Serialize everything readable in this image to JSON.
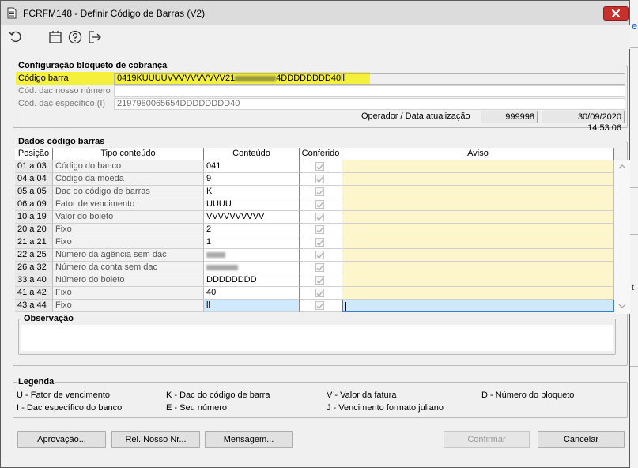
{
  "window": {
    "title": "FCRFM148 - Definir Código de Barras (V2)"
  },
  "toolbar": {
    "icons": [
      "refresh-icon",
      "calendar-icon",
      "help-icon",
      "exit-icon"
    ]
  },
  "config": {
    "legend": "Configuração bloqueto de cobrança",
    "codigo_barra_label": "Código barra",
    "codigo_barra_value_prefix": "0419KUUUUVVVVVVVVVV21",
    "codigo_barra_value_suffix": "4DDDDDDDD40ll",
    "dac_nosso_numero_label": "Cód. dac nosso número",
    "dac_nosso_numero_value": "",
    "dac_especifico_label": "Cód. dac específico (I)",
    "dac_especifico_value": "2197980065654DDDDDDDD40",
    "operador_label": "Operador / Data atualização",
    "operador_value": "999998",
    "data_value": "30/09/2020 14:53:06"
  },
  "dados": {
    "legend": "Dados código barras",
    "columns": [
      "Posição",
      "Tipo conteúdo",
      "Conteúdo",
      "Conferido",
      "Aviso"
    ],
    "rows": [
      {
        "pos": "01 a 03",
        "tipo": "Código do banco",
        "conteudo": "041",
        "conferido": true,
        "aviso": ""
      },
      {
        "pos": "04 a 04",
        "tipo": "Código da moeda",
        "conteudo": "9",
        "conferido": true,
        "aviso": ""
      },
      {
        "pos": "05 a 05",
        "tipo": "Dac do código de barras",
        "conteudo": "K",
        "conferido": true,
        "aviso": ""
      },
      {
        "pos": "06 a 09",
        "tipo": "Fator de vencimento",
        "conteudo": "UUUU",
        "conferido": true,
        "aviso": ""
      },
      {
        "pos": "10 a 19",
        "tipo": "Valor do boleto",
        "conteudo": "VVVVVVVVVV",
        "conferido": true,
        "aviso": ""
      },
      {
        "pos": "20 a 20",
        "tipo": "Fixo",
        "conteudo": "2",
        "conferido": true,
        "aviso": ""
      },
      {
        "pos": "21 a 21",
        "tipo": "Fixo",
        "conteudo": "1",
        "conferido": true,
        "aviso": ""
      },
      {
        "pos": "22 a 25",
        "tipo": "Número da agência sem dac",
        "conteudo": "",
        "conferido": true,
        "aviso": ""
      },
      {
        "pos": "26 a 32",
        "tipo": "Número da conta sem dac",
        "conteudo": "",
        "conferido": true,
        "aviso": ""
      },
      {
        "pos": "33 a 40",
        "tipo": "Número do boleto",
        "conteudo": "DDDDDDDD",
        "conferido": true,
        "aviso": ""
      },
      {
        "pos": "41 a 42",
        "tipo": "Fixo",
        "conteudo": "40",
        "conferido": true,
        "aviso": ""
      },
      {
        "pos": "43 a 44",
        "tipo": "Fixo",
        "conteudo": "ll",
        "conferido": true,
        "aviso": ""
      }
    ]
  },
  "observacao": {
    "legend": "Observação",
    "value": ""
  },
  "legenda": {
    "legend": "Legenda",
    "items": [
      "U - Fator de vencimento",
      "K - Dac do código de barra",
      "V - Valor da fatura",
      "D - Número do bloqueto",
      "I - Dac específico do banco",
      "E - Seu número",
      "J - Vencimento formato juliano"
    ]
  },
  "buttons": {
    "aprovacao": "Aprovação...",
    "rel_nosso_nr": "Rel. Nosso Nr...",
    "mensagem": "Mensagem...",
    "confirmar": "Confirmar",
    "cancelar": "Cancelar"
  },
  "colors": {
    "highlight": "#f5f03c",
    "aviso_bg": "#fdf6cd",
    "selected_row": "#cfe8fb",
    "close_red": "#c7302b"
  }
}
